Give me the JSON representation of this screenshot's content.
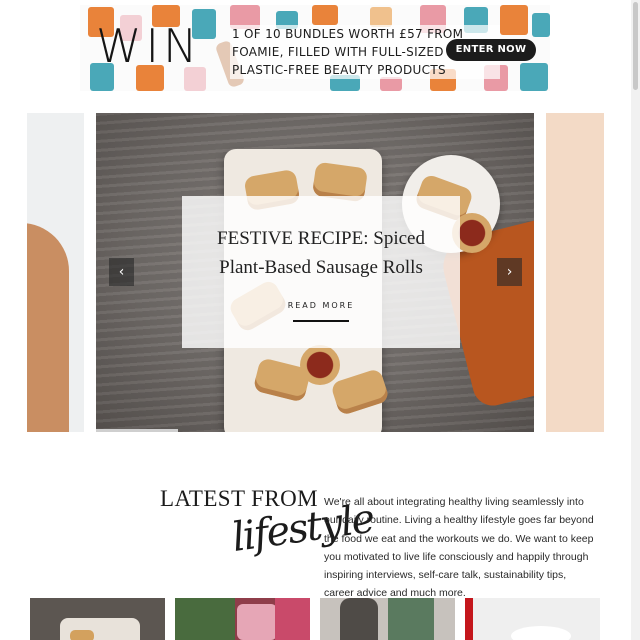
{
  "banner": {
    "headline": "WIN",
    "offer_line1": "1 OF 10 BUNDLES WORTH £57 FROM",
    "offer_line2": "FOAMIE, FILLED WITH FULL-SIZED",
    "offer_line3": "PLASTIC-FREE BEAUTY PRODUCTS",
    "cta_label": "ENTER NOW",
    "colors": {
      "accent_orange": "#e9833a",
      "accent_teal": "#4aa8b8",
      "accent_pink": "#e99aa5",
      "cta_bg": "#1c1c1c"
    }
  },
  "hero": {
    "slide_title": "FESTIVE RECIPE: Spiced Plant-Based Sausage Rolls",
    "read_more": "READ MORE",
    "prev_icon": "chevron-left-icon",
    "next_icon": "chevron-right-icon",
    "prev_glyph": "‹",
    "next_glyph": "›"
  },
  "section": {
    "heading": "LATEST FROM",
    "heading_script": "lifestyle",
    "intro": "We're all about integrating healthy living seamlessly into our daily routine. Living a healthy lifestyle goes far beyond the food we eat and the workouts we do. We want to keep you motivated to live life consciously and happily through inspiring interviews, self-care talk, sustainability tips, career advice and much more."
  }
}
